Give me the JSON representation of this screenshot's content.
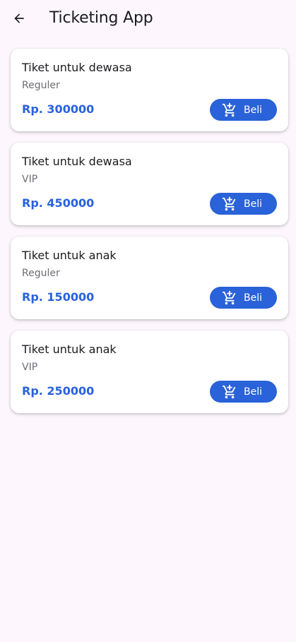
{
  "header": {
    "title": "Ticketing App",
    "back_icon": "arrow-back-icon"
  },
  "colors": {
    "accent": "#2962d9",
    "background": "#fdf7fd",
    "card": "#ffffff"
  },
  "tickets": [
    {
      "title": "Tiket untuk dewasa",
      "type": "Reguler",
      "price": "Rp. 300000",
      "button_label": "Beli",
      "button_icon": "add-to-cart-icon"
    },
    {
      "title": "Tiket untuk dewasa",
      "type": "VIP",
      "price": "Rp. 450000",
      "button_label": "Beli",
      "button_icon": "add-to-cart-icon"
    },
    {
      "title": "Tiket untuk anak",
      "type": "Reguler",
      "price": "Rp. 150000",
      "button_label": "Beli",
      "button_icon": "add-to-cart-icon"
    },
    {
      "title": "Tiket untuk anak",
      "type": "VIP",
      "price": "Rp. 250000",
      "button_label": "Beli",
      "button_icon": "add-to-cart-icon"
    }
  ]
}
